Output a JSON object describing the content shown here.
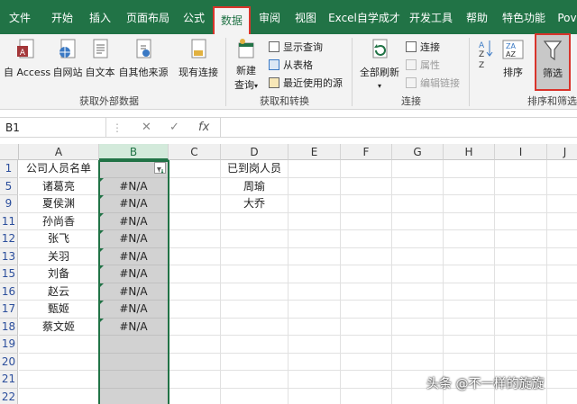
{
  "tabs": [
    "文件",
    "开始",
    "插入",
    "页面布局",
    "公式",
    "数据",
    "审阅",
    "视图",
    "Excel自学成才",
    "开发工具",
    "帮助",
    "特色功能",
    "Pov"
  ],
  "active_tab": "数据",
  "ribbon": {
    "get_external": {
      "label": "获取外部数据",
      "buttons": [
        "自 Access",
        "自网站",
        "自文本",
        "自其他来源",
        "现有连接"
      ]
    },
    "get_transform": {
      "label": "获取和转换",
      "new_query": "新建",
      "new_query2": "查询",
      "show_queries": "显示查询",
      "from_table": "从表格",
      "recent_sources": "最近使用的源"
    },
    "connections": {
      "label": "连接",
      "refresh_all": "全部刷新",
      "connections": "连接",
      "properties": "属性",
      "edit_links": "编辑链接"
    },
    "sort_filter": {
      "label": "排序和筛选",
      "sort": "排序",
      "filter": "筛选"
    }
  },
  "formula_bar": {
    "name_box": "B1",
    "fx": "fx",
    "cancel": "✕",
    "enter": "✓"
  },
  "columns": [
    "A",
    "B",
    "C",
    "D",
    "E",
    "F",
    "G",
    "H",
    "I",
    "J"
  ],
  "rows": [
    {
      "num": "1",
      "a": "公司人员名单",
      "b": "",
      "d": "已到岗人员"
    },
    {
      "num": "5",
      "a": "诸葛亮",
      "b": "#N/A",
      "d": "周瑜"
    },
    {
      "num": "9",
      "a": "夏侯渊",
      "b": "#N/A",
      "d": "大乔"
    },
    {
      "num": "11",
      "a": "孙尚香",
      "b": "#N/A",
      "d": ""
    },
    {
      "num": "12",
      "a": "张飞",
      "b": "#N/A",
      "d": ""
    },
    {
      "num": "13",
      "a": "关羽",
      "b": "#N/A",
      "d": ""
    },
    {
      "num": "15",
      "a": "刘备",
      "b": "#N/A",
      "d": ""
    },
    {
      "num": "16",
      "a": "赵云",
      "b": "#N/A",
      "d": ""
    },
    {
      "num": "17",
      "a": "甄姬",
      "b": "#N/A",
      "d": ""
    },
    {
      "num": "18",
      "a": "蔡文姬",
      "b": "#N/A",
      "d": ""
    },
    {
      "num": "19",
      "a": "",
      "b": "",
      "d": ""
    },
    {
      "num": "20",
      "a": "",
      "b": "",
      "d": ""
    },
    {
      "num": "21",
      "a": "",
      "b": "",
      "d": ""
    },
    {
      "num": "22",
      "a": "",
      "b": "",
      "d": ""
    }
  ],
  "watermark": "头条 @不一样的旋旋",
  "colors": {
    "excel_green": "#217346",
    "highlight_red": "#d9342b",
    "selected_fill": "#d2d2d2"
  }
}
